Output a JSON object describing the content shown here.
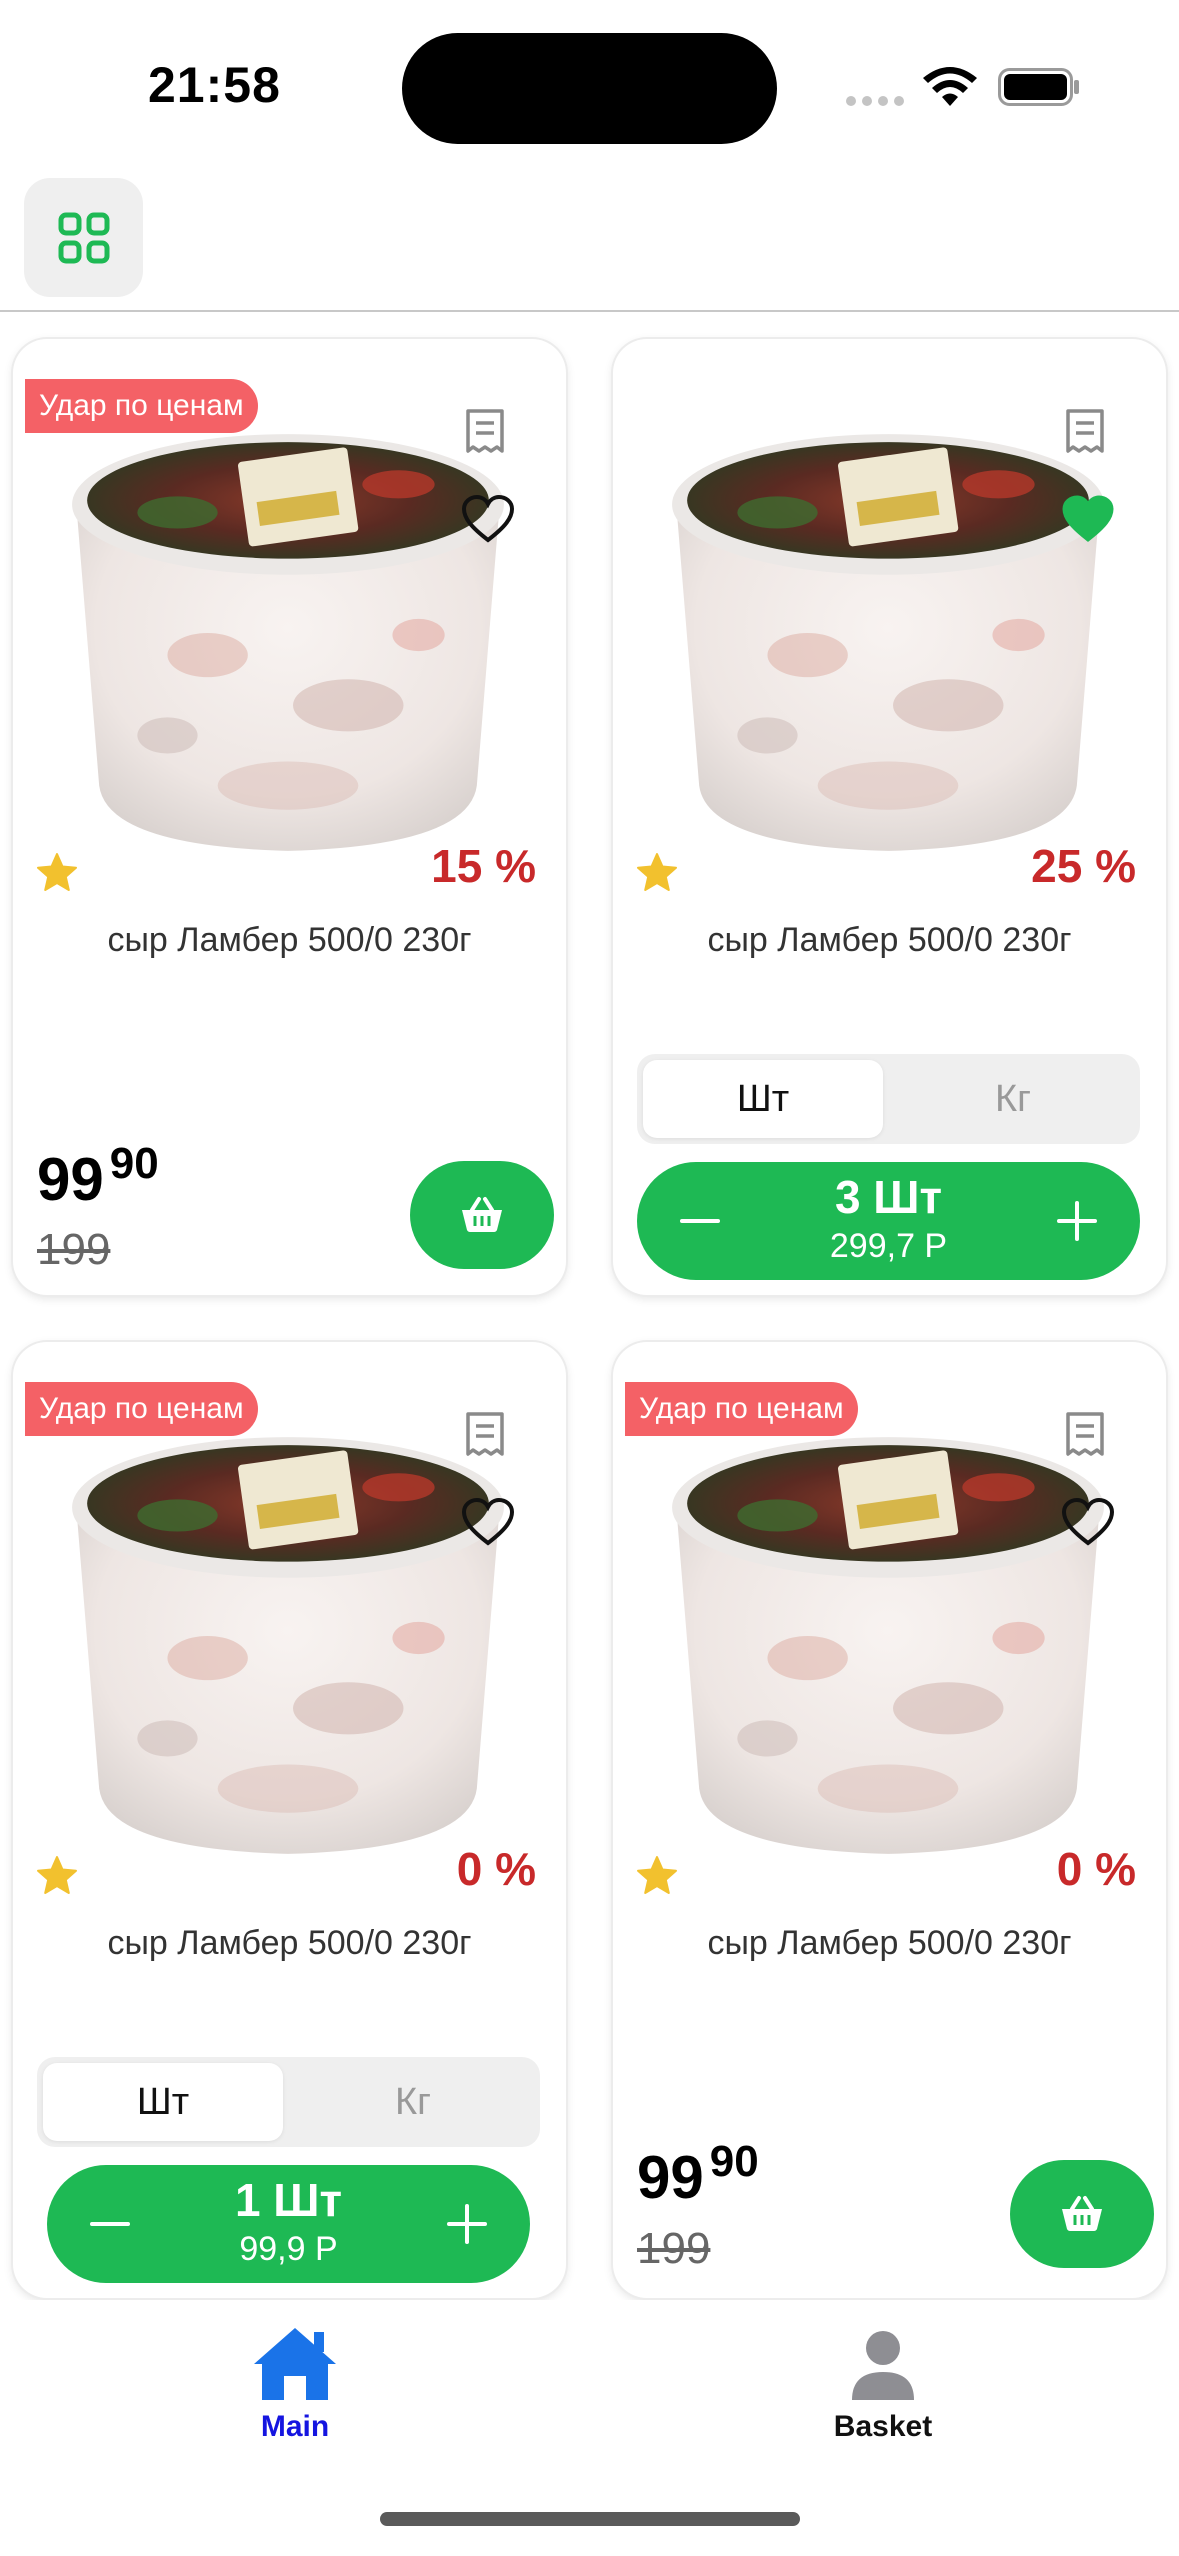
{
  "status": {
    "time": "21:58"
  },
  "toolbar": {
    "grid_icon": "grid-icon"
  },
  "colors": {
    "accent_green": "#1eb954",
    "promo_red": "#f46166",
    "discount_red": "#c8292a",
    "tab_active": "#1a73e8"
  },
  "products": [
    {
      "promo": "Удар по ценам",
      "discount": "15 %",
      "title": "сыр Ламбер 500/0 230г",
      "favorite": false,
      "price_int": "99",
      "price_frac": "90",
      "price_old": "199"
    },
    {
      "discount": "25 %",
      "title": "сыр Ламбер 500/0 230г",
      "favorite": true,
      "unit_active": "Шт",
      "unit_inactive": "Кг",
      "qty": "3 Шт",
      "qty_sum": "299,7 Р"
    },
    {
      "promo": "Удар по ценам",
      "discount": "0 %",
      "title": "сыр Ламбер 500/0 230г",
      "favorite": false,
      "unit_active": "Шт",
      "unit_inactive": "Кг",
      "qty": "1 Шт",
      "qty_sum": "99,9 Р"
    },
    {
      "promo": "Удар по ценам",
      "discount": "0 %",
      "title": "сыр Ламбер 500/0 230г",
      "favorite": false,
      "price_int": "99",
      "price_frac": "90",
      "price_old": "199"
    }
  ],
  "tabs": [
    {
      "label": "Main",
      "icon": "home-icon",
      "active": true
    },
    {
      "label": "Basket",
      "icon": "person-icon",
      "active": false
    }
  ]
}
